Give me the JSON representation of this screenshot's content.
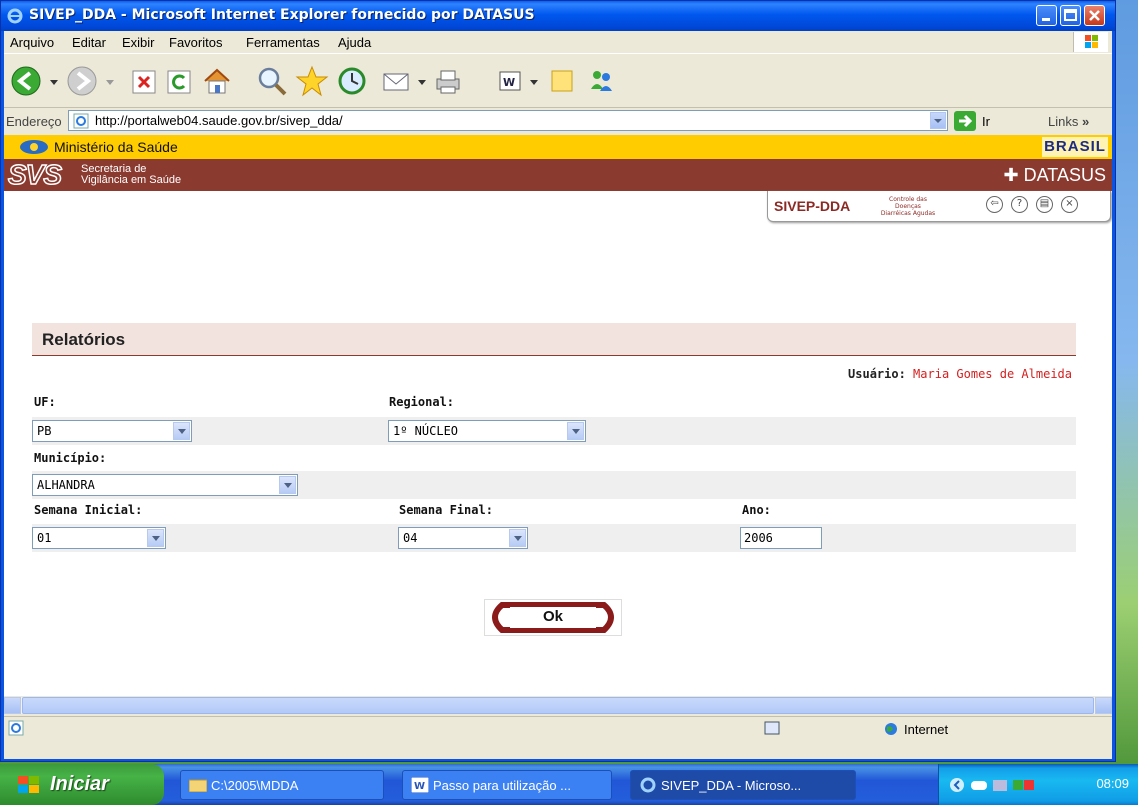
{
  "window": {
    "title": "SIVEP_DDA - Microsoft Internet Explorer fornecido por DATASUS"
  },
  "menubar": {
    "items": [
      "Arquivo",
      "Editar",
      "Exibir",
      "Favoritos",
      "Ferramentas",
      "Ajuda"
    ]
  },
  "addressbar": {
    "label": "Endereço",
    "url": "http://portalweb04.saude.gov.br/sivep_dda/",
    "go_label": "Ir",
    "links_label": "Links"
  },
  "header": {
    "ministry": "Ministério da Saúde",
    "brasil": "BRASIL",
    "svs_logo": "SVS",
    "svs_line1": "Secretaria de",
    "svs_line2": "Vigilância em Saúde",
    "datasus": "DATASUS",
    "sivep_title": "SIVEP-DDA",
    "sivep_sub": "Controle das Doenças Diarréicas Agudas"
  },
  "page": {
    "section_title": "Relatórios",
    "user_label": "Usuário:",
    "user_name": "Maria Gomes de Almeida",
    "uf_label": "UF:",
    "uf_value": "PB",
    "regional_label": "Regional:",
    "regional_value": "1º NÚCLEO",
    "municipio_label": "Município:",
    "municipio_value": "ALHANDRA",
    "semana_inicial_label": "Semana Inicial:",
    "semana_inicial_value": "01",
    "semana_final_label": "Semana Final:",
    "semana_final_value": "04",
    "ano_label": "Ano:",
    "ano_value": "2006",
    "ok_label": "Ok"
  },
  "statusbar": {
    "zone": "Internet"
  },
  "taskbar": {
    "start_label": "Iniciar",
    "tasks": [
      "C:\\2005\\MDDA",
      "Passo para utilização ...",
      "SIVEP_DDA - Microso..."
    ],
    "clock": "08:09"
  }
}
